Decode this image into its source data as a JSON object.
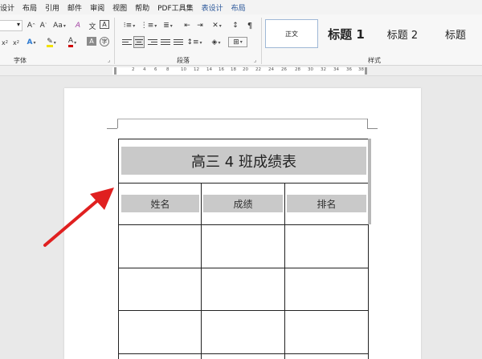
{
  "menu": {
    "items": [
      "设计",
      "布局",
      "引用",
      "邮件",
      "审阅",
      "视图",
      "帮助",
      "PDF工具集",
      "表设计",
      "布局"
    ]
  },
  "ribbon": {
    "groups": {
      "font": "字体",
      "paragraph": "段落",
      "styles": "样式"
    },
    "styles_gallery": [
      {
        "label": "正文",
        "selected": true
      },
      {
        "label": "标题 1",
        "selected": false
      },
      {
        "label": "标题 2",
        "selected": false
      },
      {
        "label": "标题",
        "selected": false
      }
    ]
  },
  "ruler": {
    "ticks": [
      "2",
      "4",
      "6",
      "8",
      "10",
      "12",
      "14",
      "16",
      "18",
      "20",
      "22",
      "24",
      "26",
      "28",
      "30",
      "32",
      "34",
      "36",
      "38"
    ]
  },
  "table": {
    "title": "高三 4 班成绩表",
    "headers": [
      "姓名",
      "成绩",
      "排名"
    ]
  },
  "colors": {
    "accent": "#2b579a",
    "cell_shading": "#c9c9c9",
    "arrow": "#e02020"
  }
}
